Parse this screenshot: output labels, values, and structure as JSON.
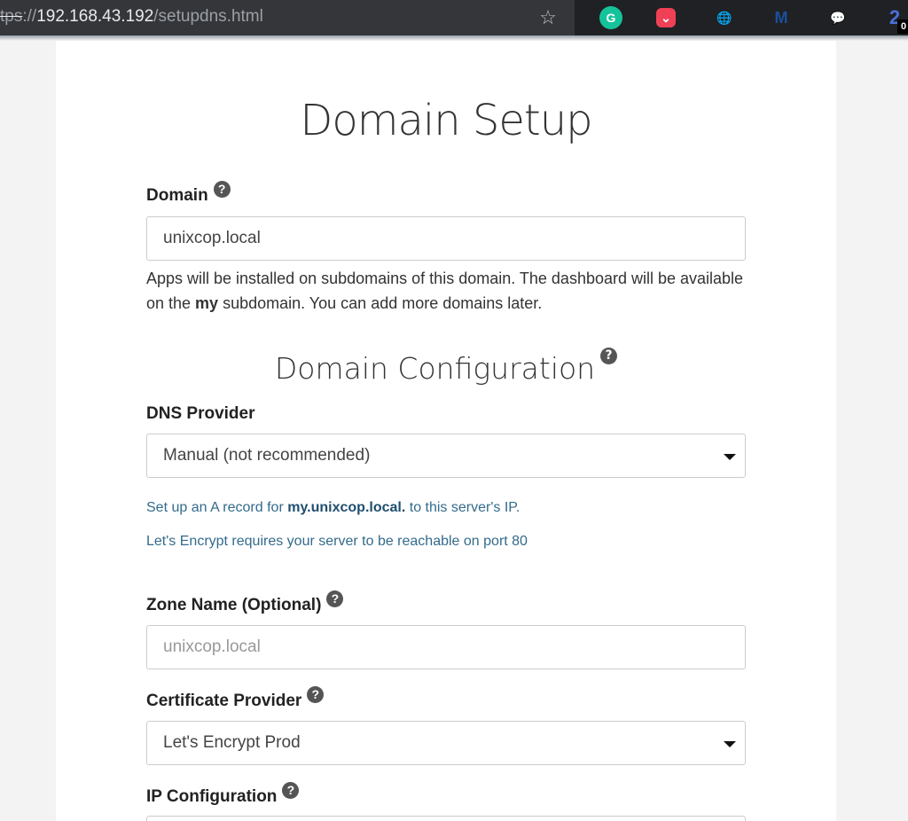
{
  "browser": {
    "url_scheme": "tps",
    "url_sep": "://",
    "url_host": "192.168.43.192",
    "url_path": "/setupdns.html",
    "extensions": [
      {
        "name": "grammarly",
        "glyph": "G"
      },
      {
        "name": "pocket",
        "glyph": "⌄"
      },
      {
        "name": "idm",
        "glyph": "🌐"
      },
      {
        "name": "m",
        "glyph": "M"
      },
      {
        "name": "chat",
        "glyph": "💬"
      },
      {
        "name": "two",
        "glyph": "2"
      }
    ],
    "badge": "0"
  },
  "page": {
    "title": "Domain Setup",
    "domain_label": "Domain",
    "domain_value": "unixcop.local",
    "domain_help_1": "Apps will be installed on subdomains of this domain. The dashboard will be available on the ",
    "domain_help_bold": "my",
    "domain_help_2": " subdomain. You can add more domains later.",
    "section_title": "Domain Configuration",
    "dns_label": "DNS Provider",
    "dns_value": "Manual (not recommended)",
    "a_record_1": "Set up an A record for ",
    "a_record_bold": "my.unixcop.local.",
    "a_record_2": " to this server's IP.",
    "letsencrypt_note": "Let's Encrypt requires your server to be reachable on port 80",
    "zone_label": "Zone Name (Optional)",
    "zone_placeholder": "unixcop.local",
    "cert_label": "Certificate Provider",
    "cert_value": "Let's Encrypt Prod",
    "ip_label": "IP Configuration",
    "help_glyph": "?"
  }
}
